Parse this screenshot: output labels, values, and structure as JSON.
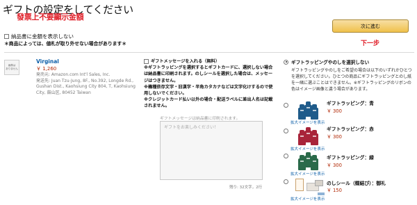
{
  "header": {
    "title": "ギフトの設定をしてください",
    "red_note": "發票上不要顯示金額",
    "hide_price_label": "納品書に金額を表示しない",
    "warning": "＊商品によっては、値札が取り外せない場合があります＊"
  },
  "actions": {
    "continue_label": "次に進む",
    "next_note": "下一步"
  },
  "product": {
    "thumb_text": "画像は\nありません",
    "name": "Virginal",
    "price": "￥ 1,260",
    "seller": "発売元: Amazon.com Int'l Sales, Inc.",
    "ship_to": "発送先: Juan Tzu-Jung, 8F., No.392, Longde Rd., Gushan Dist., Kaohsiung City 804, T, Kaohsiung City, 鼓山区, 80452 Taiwan"
  },
  "message": {
    "checkbox_label": "ギフトメッセージを入れる（無料）",
    "notes": [
      "※ギフトラッピングを選択するとギフトカードに、選択しない場合は納品書に印刷されます。のしシールを選択した場合は、メッセージはつきません。",
      "※機種依存文字・旧漢字・半角カタカナなどは文字化けするので使用しないでください。",
      "※クレジットカード払い以外の場合・配送ラベルに差出人名は記載されません。"
    ],
    "subnote": "ギフトメッセージは納品書に印刷されます。",
    "placeholder": "ギフトをお楽しみください！",
    "char_count": "残り: 32文字，2行"
  },
  "wrap": {
    "none_label": "ギフトラッピングやのしを選択しない",
    "none_desc": "ギフトラッピングやのしをご希望の場合は以下のいずれかひとつを選択してください。ひとつの商品にギフトラッピングとのし紙を一緒に選ぶことはできません。※ギフトラッピングのリボンの色はイメージ画像と違う場合があります。",
    "options": [
      {
        "name": "ギフトラッピング：青",
        "price": "￥ 300",
        "link": "拡大イメージを表示",
        "color": "#1f5b8a"
      },
      {
        "name": "ギフトラッピング：赤",
        "price": "￥ 300",
        "link": "拡大イメージを表示",
        "color": "#a8243a"
      },
      {
        "name": "ギフトラッピング：緑",
        "price": "￥ 300",
        "link": "拡大イメージを表示",
        "color": "#2a6a4a"
      },
      {
        "name": "のしシール（蝶結び）：御礼",
        "price": "￥ 150",
        "link": "拡大イメージを表示"
      }
    ]
  },
  "colors": {
    "accent_red": "#e0202a",
    "link_blue": "#0b5ea8",
    "price_red": "#b12704",
    "button_yellow": "#f0c14b"
  }
}
